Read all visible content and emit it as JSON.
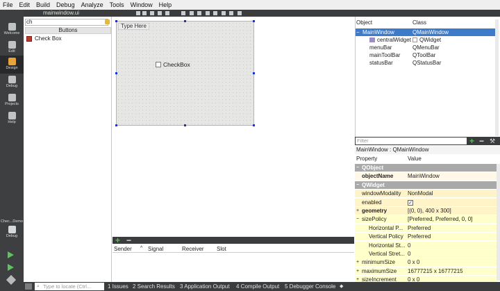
{
  "menu": [
    "File",
    "Edit",
    "Build",
    "Debug",
    "Analyze",
    "Tools",
    "Window",
    "Help"
  ],
  "modes": [
    {
      "label": "Welcome",
      "icon": "welcome-icon"
    },
    {
      "label": "Edit",
      "icon": "edit-icon"
    },
    {
      "label": "Design",
      "icon": "design-icon",
      "active": true
    },
    {
      "label": "Debug",
      "icon": "debug-icon"
    },
    {
      "label": "Projects",
      "icon": "projects-icon"
    },
    {
      "label": "Help",
      "icon": "help-icon"
    }
  ],
  "kit": {
    "label": "Chec...Demo",
    "sub": "Debug"
  },
  "document": {
    "title": "mainwindow.ui"
  },
  "widget_box": {
    "filter_value": "ch",
    "group": "Buttons",
    "item": "Check Box"
  },
  "form": {
    "menu_placeholder": "Type Here",
    "checkbox_label": "CheckBox"
  },
  "signals": {
    "add": "+",
    "remove": "−",
    "columns": [
      "Sender",
      "Signal",
      "Receiver",
      "Slot"
    ]
  },
  "object_inspector": {
    "headers": [
      "Object",
      "Class"
    ],
    "rows": [
      {
        "name": "MainWindow",
        "class": "QMainWindow",
        "selected": true
      },
      {
        "name": "centralWidget",
        "class": "QWidget"
      },
      {
        "name": "menuBar",
        "class": "QMenuBar"
      },
      {
        "name": "mainToolBar",
        "class": "QToolBar"
      },
      {
        "name": "statusBar",
        "class": "QStatusBar"
      }
    ]
  },
  "property_editor": {
    "filter_placeholder": "Filter",
    "title": "MainWindow : QMainWindow",
    "headers": [
      "Property",
      "Value"
    ],
    "rows": [
      {
        "name": "QObject",
        "value": "",
        "kind": "group"
      },
      {
        "name": "objectName",
        "value": "MainWindow",
        "kind": "a",
        "bold": true
      },
      {
        "name": "QWidget",
        "value": "",
        "kind": "group"
      },
      {
        "name": "windowModality",
        "value": "NonModal",
        "kind": "b"
      },
      {
        "name": "enabled",
        "value": "✓",
        "kind": "b",
        "check": true
      },
      {
        "name": "geometry",
        "value": "[(0, 0), 400 x 300]",
        "kind": "b",
        "bold": true,
        "expander": "+"
      },
      {
        "name": "sizePolicy",
        "value": "[Preferred, Preferred, 0, 0]",
        "kind": "c",
        "expander": "−"
      },
      {
        "name": "Horizontal P...",
        "value": "Preferred",
        "kind": "c",
        "indent": true
      },
      {
        "name": "Vertical Policy",
        "value": "Preferred",
        "kind": "c",
        "indent": true
      },
      {
        "name": "Horizontal St...",
        "value": "0",
        "kind": "c",
        "indent": true
      },
      {
        "name": "Vertical Stret...",
        "value": "0",
        "kind": "c",
        "indent": true
      },
      {
        "name": "minimumSize",
        "value": "0 x 0",
        "kind": "c",
        "expander": "+"
      },
      {
        "name": "maximumSize",
        "value": "16777215 x 16777215",
        "kind": "c",
        "expander": "+"
      },
      {
        "name": "sizeIncrement",
        "value": "0 x 0",
        "kind": "c",
        "expander": "+"
      }
    ]
  },
  "status": {
    "locate_placeholder": "Type to locate (Ctrl...",
    "tabs": [
      "1 Issues",
      "2 Search Results",
      "3 Application Output",
      "4 Compile Output",
      "5 Debugger Console"
    ]
  }
}
